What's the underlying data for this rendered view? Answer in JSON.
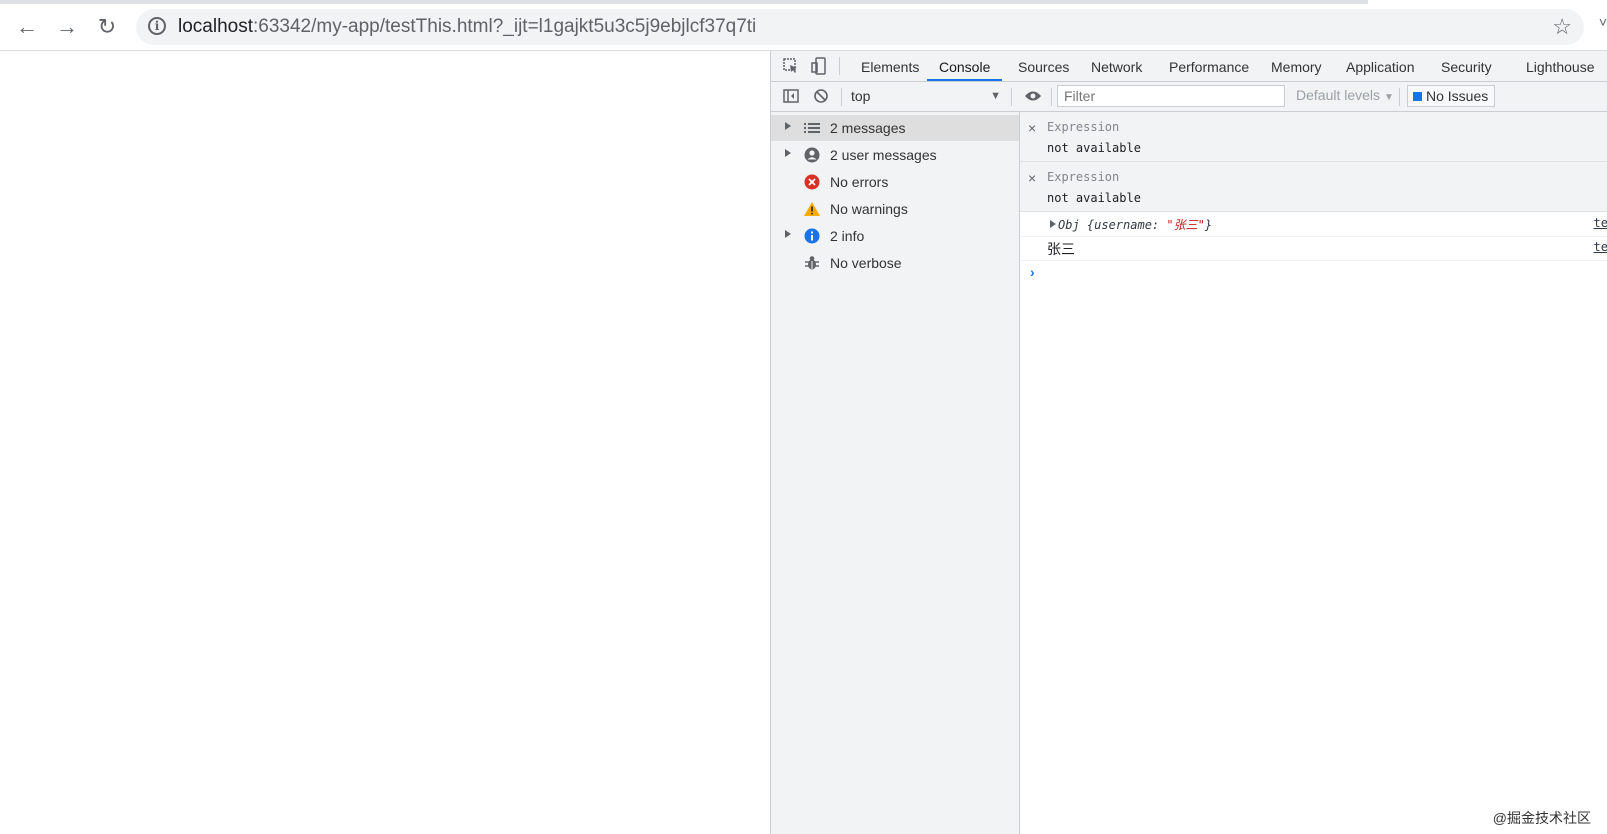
{
  "browser": {
    "url_host": "localhost",
    "url_rest": ":63342/my-app/testThis.html?_ijt=l1gajkt5u3c5j9ebjlcf37q7ti",
    "icons": [
      "back-arrow-icon",
      "forward-arrow-icon",
      "reload-icon",
      "info-icon",
      "star-icon"
    ]
  },
  "devtools": {
    "tabs": [
      {
        "label": "Elements"
      },
      {
        "label": "Console",
        "active": true
      },
      {
        "label": "Sources"
      },
      {
        "label": "Network"
      },
      {
        "label": "Performance"
      },
      {
        "label": "Memory"
      },
      {
        "label": "Application"
      },
      {
        "label": "Security"
      },
      {
        "label": "Lighthouse"
      }
    ],
    "toolbar": {
      "context": "top",
      "filter_placeholder": "Filter",
      "levels": "Default levels",
      "issues": "No Issues"
    },
    "sidebar": [
      {
        "label": "2 messages",
        "icon": "list-icon",
        "expandable": true,
        "selected": true
      },
      {
        "label": "2 user messages",
        "icon": "user-icon",
        "expandable": true
      },
      {
        "label": "No errors",
        "icon": "error-icon",
        "expandable": false
      },
      {
        "label": "No warnings",
        "icon": "warning-icon",
        "expandable": false
      },
      {
        "label": "2 info",
        "icon": "info-icon",
        "expandable": true
      },
      {
        "label": "No verbose",
        "icon": "bug-icon",
        "expandable": false
      }
    ],
    "console": {
      "expressions": [
        {
          "name": "Expression",
          "value": "not available"
        },
        {
          "name": "Expression",
          "value": "not available"
        }
      ],
      "messages": {
        "obj_prefix": "Obj {username: ",
        "obj_string": "\"张三\"",
        "obj_suffix": "}",
        "text": "张三",
        "source": "te"
      }
    }
  },
  "watermark": "@掘金技术社区",
  "colors": {
    "accent": "#1a73e8",
    "error": "#d93025",
    "warning": "#f9ab00",
    "info": "#1a73e8",
    "string": "#c41a16"
  }
}
